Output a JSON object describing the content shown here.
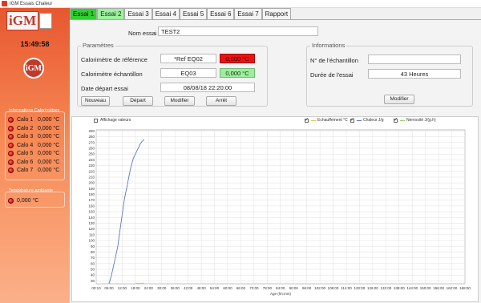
{
  "window": {
    "title": "IGM Essais Chaleur"
  },
  "sidebar": {
    "time": "15:49:58",
    "logo_text": "iGM",
    "round_logo_text": "iGM",
    "calo_group_title": "Informations Calorimètres",
    "calos": [
      {
        "label": "Calo 1",
        "value": "0,000 °C"
      },
      {
        "label": "Calo 2",
        "value": "0,000 °C"
      },
      {
        "label": "Calo 3",
        "value": "0,000 °C"
      },
      {
        "label": "Calo 4",
        "value": "0,000 °C"
      },
      {
        "label": "Calo 5",
        "value": "0,000 °C"
      },
      {
        "label": "Calo 6",
        "value": "0,000 °C"
      },
      {
        "label": "Calo 7",
        "value": "0,000 °C"
      }
    ],
    "ambient_group_title": "Température ambiante",
    "ambient_value": "0,000 °C"
  },
  "tabs": [
    "Essai 1",
    "Essai 2",
    "Essai 3",
    "Essai 4",
    "Essai 5",
    "Essai 6",
    "Essai 7",
    "Rapport"
  ],
  "form": {
    "nom_label": "Nom essai",
    "nom_value": "TEST2",
    "params_title": "Paramètres",
    "ref_label": "Calorimètre de référence",
    "ref_value": "*Ref EQ02",
    "ref_temp": "0,000 °C",
    "ech_label": "Calorimètre échantillon",
    "ech_value": "EQ03",
    "ech_temp": "0,000 °C",
    "date_label": "Date départ essai",
    "date_value": "08/08/18 22:20:00",
    "btn_nouveau": "Nouveau",
    "btn_depart": "Départ",
    "btn_modifier": "Modifier",
    "btn_arret": "Arrêt",
    "info_title": "Informations",
    "num_label": "N° de l'échantillon",
    "num_value": "",
    "duree_label": "Durée de l'essai",
    "duree_value": "43 Heures",
    "btn_modifier2": "Modifier"
  },
  "chart_header": {
    "affichage": "Affichage valeurs",
    "legend_echauffement": "Echauffement °C",
    "legend_chaleur": "Chaleur J/g",
    "legend_nervosite": "Nervosité J/(g.h)"
  },
  "colors": {
    "echauffement": "#e8c64a",
    "chaleur": "#5a7bb5",
    "nervosite": "#9bd36a"
  },
  "chart_data": {
    "type": "line",
    "xlabel": "Age (hh:mm)",
    "ylabel": "",
    "x_ticks": [
      "00:10",
      "06:00",
      "12:00",
      "18:00",
      "24:00",
      "30:00",
      "36:00",
      "42:00",
      "48:00",
      "54:00",
      "60:00",
      "66:00",
      "72:00",
      "78:00",
      "84:00",
      "90:00",
      "96:00",
      "102:00",
      "108:00",
      "114:00",
      "120:00",
      "126:00",
      "132:00",
      "138:00",
      "144:00",
      "150:00",
      "156:00",
      "162:00",
      "168:00"
    ],
    "x_hours": [
      0.17,
      6,
      12,
      18,
      24,
      30,
      36,
      42,
      48,
      54,
      60,
      66,
      72,
      78,
      84,
      90,
      96,
      102,
      108,
      114,
      120,
      126,
      132,
      138,
      144,
      150,
      156,
      162,
      168
    ],
    "xlim": [
      0.17,
      168
    ],
    "y_ticks": [
      30,
      40,
      50,
      60,
      70,
      80,
      90,
      100,
      110,
      120,
      130,
      140,
      150,
      160,
      170,
      180,
      190,
      200,
      210,
      220,
      230,
      240,
      250,
      260,
      270,
      280,
      290
    ],
    "ylim": [
      25,
      292
    ],
    "series": [
      {
        "name": "Chaleur J/g",
        "x": [
          6,
          7,
          8,
          9,
          10,
          11,
          12,
          13,
          14,
          15,
          16,
          17,
          18,
          19,
          20,
          21,
          22
        ],
        "y": [
          25,
          38,
          55,
          72,
          90,
          118,
          145,
          172,
          190,
          210,
          228,
          242,
          250,
          258,
          266,
          272,
          275
        ]
      },
      {
        "name": "Echauffement °C",
        "x": [
          18,
          19,
          20,
          21,
          22
        ],
        "y": [
          26,
          26,
          26,
          26,
          26
        ]
      }
    ]
  }
}
